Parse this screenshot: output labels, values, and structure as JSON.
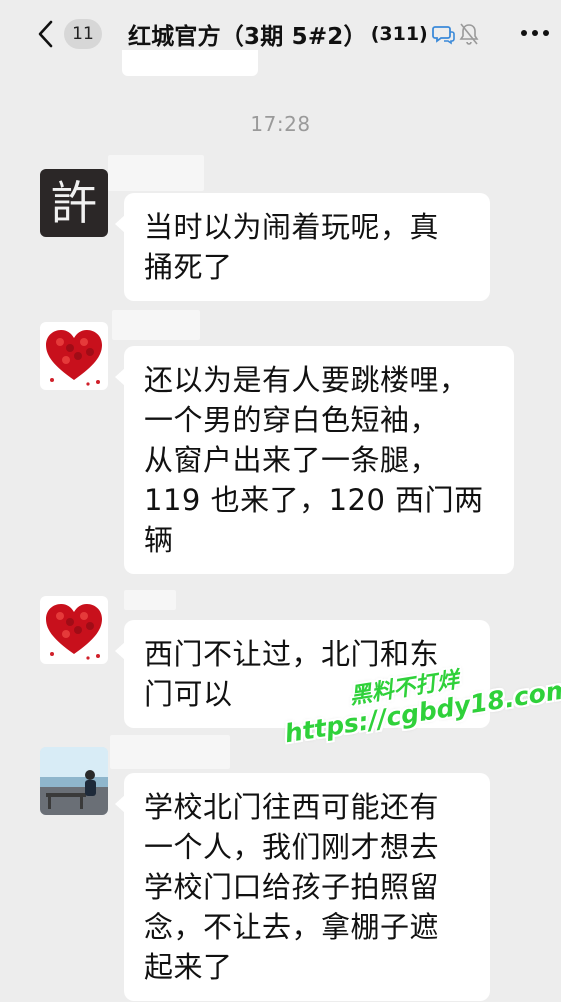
{
  "nav": {
    "unread_count": "11",
    "title": "红城官方（3期 5#2）",
    "member_count": "(311)",
    "icons": [
      "back-chevron-icon",
      "chat-bubbles-icon",
      "mute-bell-icon",
      "more-dots-icon"
    ]
  },
  "timestamp": "17:28",
  "messages": [
    {
      "avatar": "许-calligraphy",
      "avatar_char": "許",
      "lines": [
        "当时以为闹着玩呢，真",
        "捅死了"
      ]
    },
    {
      "avatar": "red-rose-heart",
      "lines": [
        "还以为是有人要跳楼哩，",
        "一个男的穿白色短袖，",
        "从窗户出来了一条腿，",
        "119 也来了，120 西门两",
        "辆"
      ]
    },
    {
      "avatar": "red-rose-heart",
      "lines": [
        "西门不让过，北门和东",
        "门可以"
      ]
    },
    {
      "avatar": "person-on-bench-photo",
      "lines": [
        "学校北门往西可能还有",
        "一个人，我们刚才想去",
        "学校门口给孩子拍照留",
        "念，不让去，拿棚子遮",
        "起来了"
      ]
    }
  ],
  "watermark": {
    "line1": "黑料不打烊",
    "line2": "https://cgbdy18.com",
    "color": "#2fd13a"
  },
  "colors": {
    "background": "#ededed",
    "bubble": "#ffffff",
    "timestamp": "#9a9a9a",
    "heart": "#c8101c"
  }
}
